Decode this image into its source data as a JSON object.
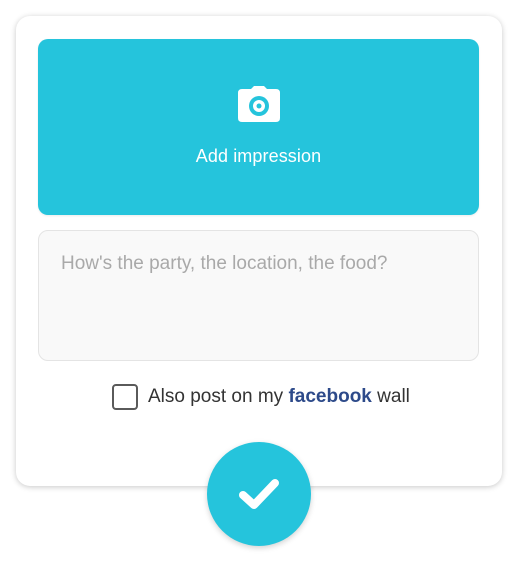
{
  "photo": {
    "label": "Add impression",
    "icon": "camera-icon"
  },
  "comment": {
    "placeholder": "How's the party, the location, the food?",
    "value": ""
  },
  "facebook": {
    "checked": false,
    "text_before": "Also post on my",
    "brand": "facebook",
    "text_after": "wall"
  },
  "confirm": {
    "icon": "check-icon"
  },
  "colors": {
    "accent": "#25c4dc",
    "facebook": "#2d4a8a"
  }
}
